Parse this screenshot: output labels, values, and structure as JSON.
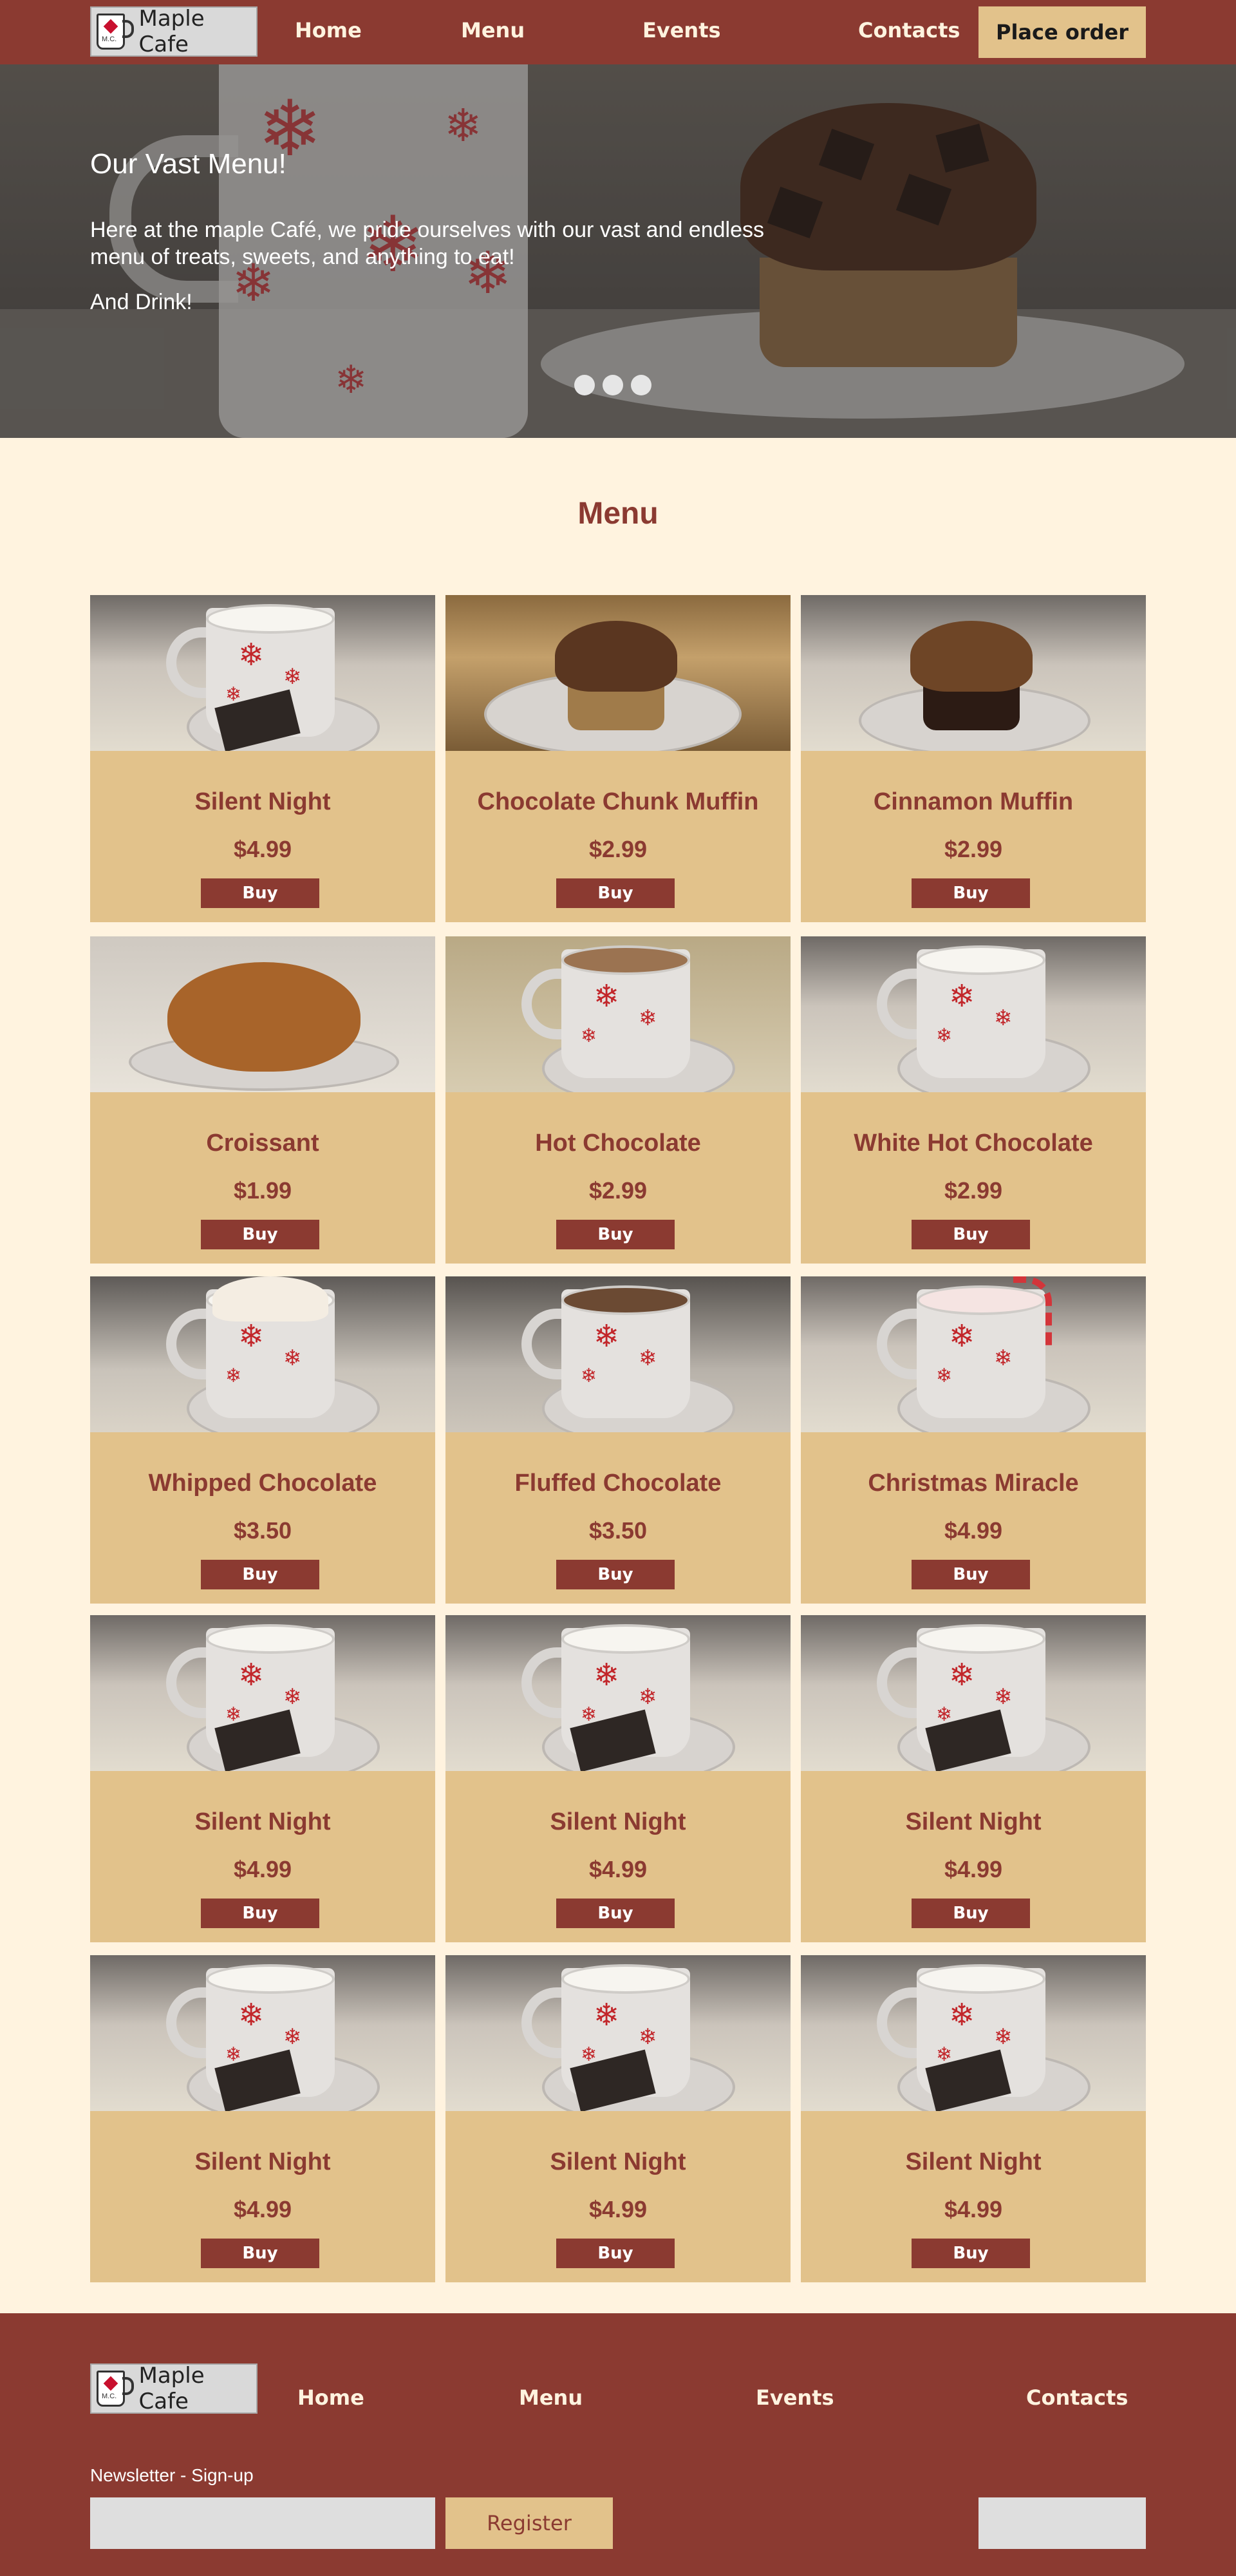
{
  "brand": {
    "name": "Maple Cafe",
    "logo_initials": "M.C."
  },
  "nav": {
    "home": "Home",
    "menu": "Menu",
    "events": "Events",
    "contacts": "Contacts",
    "order": "Place order"
  },
  "hero": {
    "title": "Our Vast Menu!",
    "text": "Here at the maple Café, we pride ourselves with our vast and endless menu of treats, sweets, and anything to eat!",
    "text2": "And Drink!",
    "slides": 3
  },
  "menu": {
    "heading": "Menu",
    "buy_label": "Buy",
    "items": [
      {
        "name": "Silent Night",
        "price": "$4.99",
        "photo": "milk-mug-chocolate"
      },
      {
        "name": "Chocolate Chunk Muffin",
        "price": "$2.99",
        "photo": "chocolate-muffin"
      },
      {
        "name": "Cinnamon Muffin",
        "price": "$2.99",
        "photo": "cinnamon-muffin"
      },
      {
        "name": "Croissant",
        "price": "$1.99",
        "photo": "croissant"
      },
      {
        "name": "Hot Chocolate",
        "price": "$2.99",
        "photo": "coffee-mug"
      },
      {
        "name": "White Hot Chocolate",
        "price": "$2.99",
        "photo": "milk-mug"
      },
      {
        "name": "Whipped Chocolate",
        "price": "$3.50",
        "photo": "cream-mug"
      },
      {
        "name": "Fluffed Chocolate",
        "price": "$3.50",
        "photo": "marshmallow-mug"
      },
      {
        "name": "Christmas Miracle",
        "price": "$4.99",
        "photo": "candy-cane-mug"
      },
      {
        "name": "Silent Night",
        "price": "$4.99",
        "photo": "milk-mug-chocolate"
      },
      {
        "name": "Silent Night",
        "price": "$4.99",
        "photo": "milk-mug-chocolate"
      },
      {
        "name": "Silent Night",
        "price": "$4.99",
        "photo": "milk-mug-chocolate"
      },
      {
        "name": "Silent Night",
        "price": "$4.99",
        "photo": "milk-mug-chocolate"
      },
      {
        "name": "Silent Night",
        "price": "$4.99",
        "photo": "milk-mug-chocolate"
      },
      {
        "name": "Silent Night",
        "price": "$4.99",
        "photo": "milk-mug-chocolate"
      }
    ]
  },
  "footer": {
    "home": "Home",
    "menu": "Menu",
    "events": "Events",
    "contacts": "Contacts",
    "newsletter_label": "Newsletter - Sign-up",
    "register": "Register"
  },
  "colors": {
    "brand": "#8b3a31",
    "card": "#e2c28b",
    "background": "#fff3df"
  }
}
